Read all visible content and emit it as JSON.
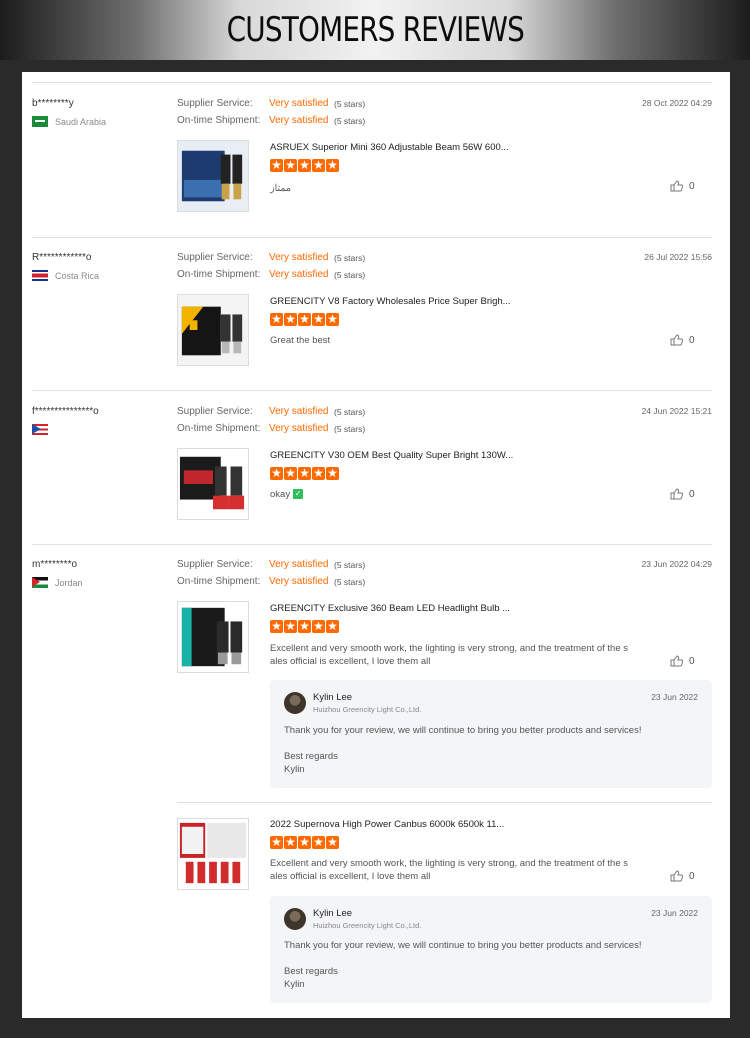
{
  "banner": {
    "title": "CUSTOMERS REVIEWS"
  },
  "labels": {
    "supplier_service": "Supplier Service:",
    "ontime_shipment": "On-time Shipment:",
    "rating_value": "Very satisfied",
    "rating_stars": "(5 stars)"
  },
  "reviews": [
    {
      "user": "b********y",
      "country": "Saudi Arabia",
      "date": "28 Oct 2022 04:29",
      "product": "ASRUEX Superior Mini 360 Adjustable Beam 56W 600...",
      "comment": "ممتاز",
      "likes": "0"
    },
    {
      "user": "R************o",
      "country": "Costa Rica",
      "date": "26 Jul 2022 15:56",
      "product": "GREENCITY V8 Factory Wholesales Price Super Brigh...",
      "comment": "Great the best",
      "likes": "0"
    },
    {
      "user": "f***************o",
      "country": "",
      "date": "24 Jun 2022 15:21",
      "product": "GREENCITY V30 OEM Best Quality Super Bright 130W...",
      "comment": "okay",
      "likes": "0"
    },
    {
      "user": "m********o",
      "country": "Jordan",
      "date": "23 Jun 2022 04:29",
      "items": [
        {
          "product": "GREENCITY Exclusive 360 Beam LED Headlight Bulb ...",
          "comment": "Excellent and very smooth work, the lighting is very strong, and the treatment of the sales official is excellent, I love them all",
          "likes": "0",
          "reply": {
            "name": "Kylin Lee",
            "company": "Huizhou Greencity Light Co.,Ltd.",
            "date": "23 Jun 2022",
            "text": "Thank you for your review, we will continue to bring you better products and services!",
            "closing": "Best regards",
            "signature": "Kylin"
          }
        },
        {
          "product": "2022 Supernova High Power Canbus 6000k 6500k 11...",
          "comment": "Excellent and very smooth work, the lighting is very strong, and the treatment of the sales official is excellent, I love them all",
          "likes": "0",
          "reply": {
            "name": "Kylin Lee",
            "company": "Huizhou Greencity Light Co.,Ltd.",
            "date": "23 Jun 2022",
            "text": "Thank you for your review, we will continue to bring you better products and services!",
            "closing": "Best regards",
            "signature": "Kylin"
          }
        }
      ]
    }
  ],
  "colors": {
    "accent": "#ff6a00",
    "verified": "#2fbf5a"
  }
}
